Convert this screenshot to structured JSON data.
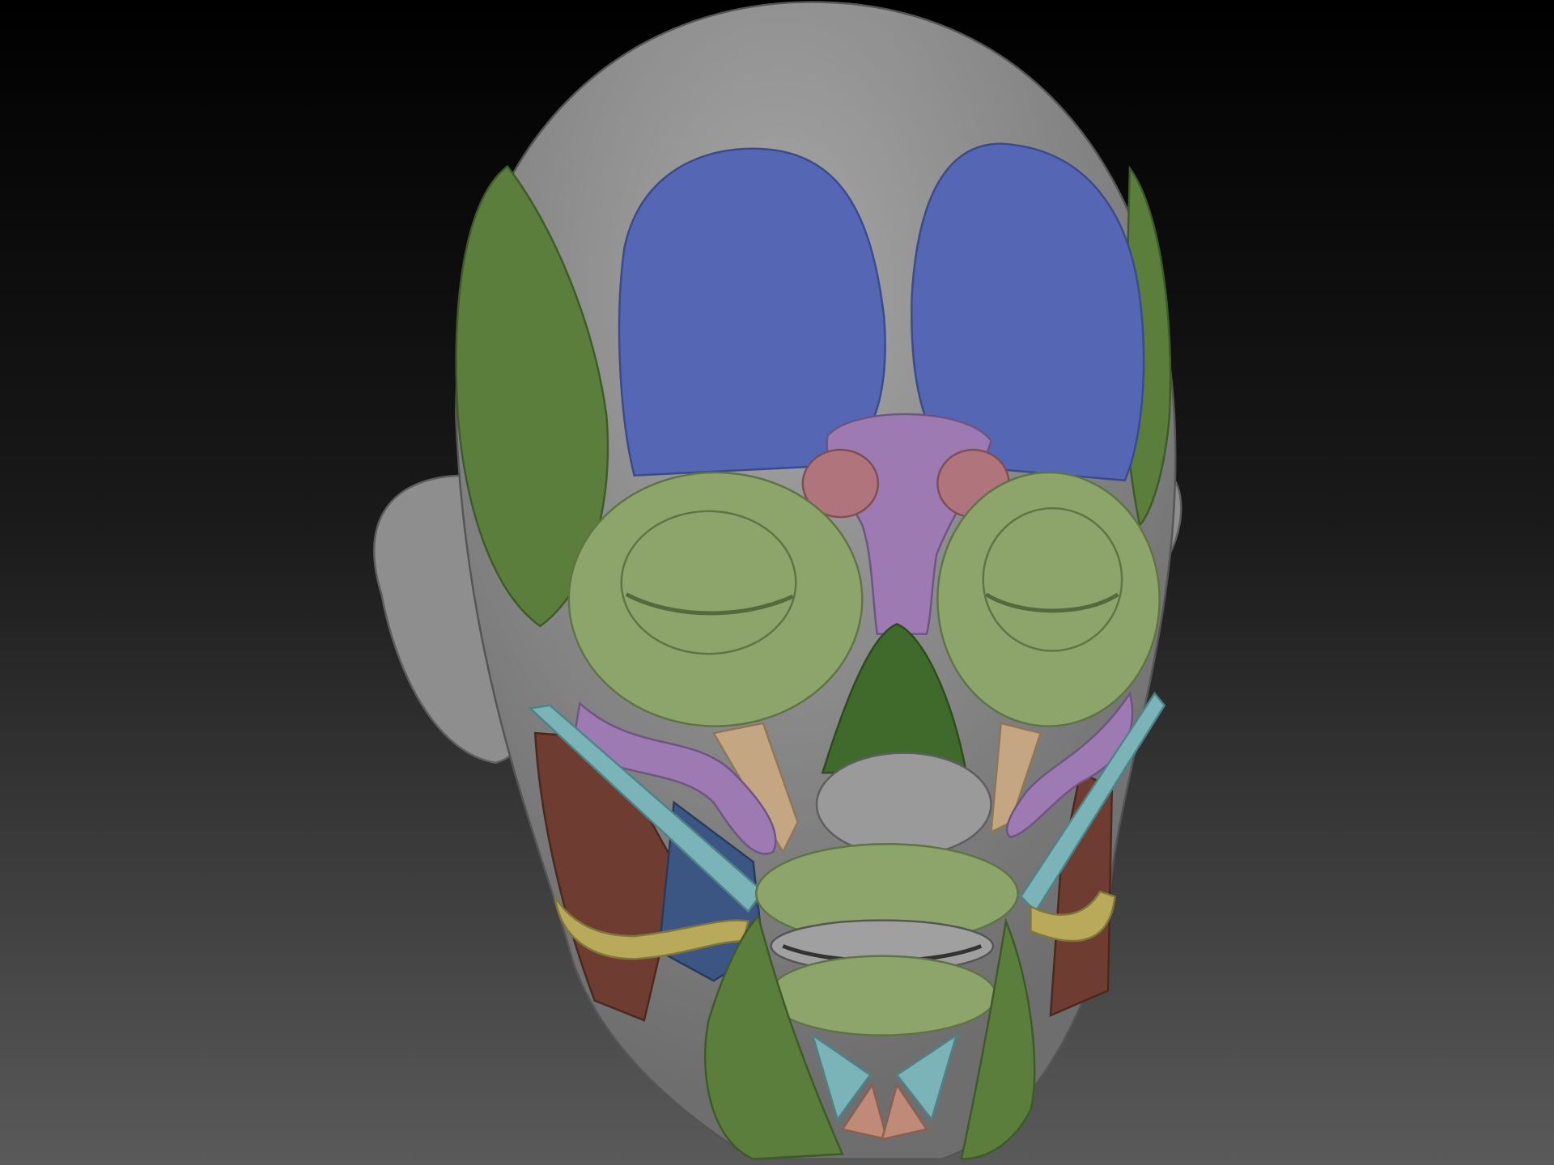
{
  "palette": {
    "background_top": "#000000",
    "background_bottom": "#5a5a5a",
    "skin": "#8e8e8e",
    "frontalis": "#5566b4",
    "temporalis": "#5c7e3c",
    "orbicularis": "#8da46a",
    "procerus": "#9d7ab2",
    "corrugator": "#b0747c",
    "masseter": "#6e3c30",
    "zygomaticus": "#7ab4b8",
    "risorius": "#b8aa5a"
  }
}
